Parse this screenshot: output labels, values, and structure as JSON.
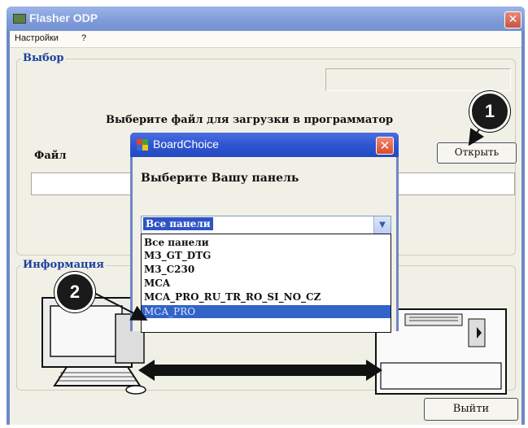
{
  "window": {
    "title": "Flasher ODP",
    "close_glyph": "✕"
  },
  "menu": {
    "items": [
      "Настройки",
      "?"
    ]
  },
  "group_choice": {
    "title": "Выбор",
    "instruction": "Выберите файл для загрузки в программатор",
    "file_label": "Файл",
    "open_button": "Открыть",
    "file_value": ""
  },
  "group_info": {
    "title": "Информация"
  },
  "exit_button": "Выйти",
  "dialog": {
    "title": "BoardChoice",
    "close_glyph": "✕",
    "prompt": "Выберите Вашу панель",
    "selected": "Все панели",
    "options": [
      "Все панели",
      "M3_GT_DTG",
      "M3_C230",
      "MCA",
      "MCA_PRO_RU_TR_RO_SI_NO_CZ",
      "MCA_PRO"
    ],
    "highlighted_option": "MCA_PRO"
  },
  "callouts": [
    "1",
    "2"
  ],
  "colors": {
    "titlebar": "#7f9ad8",
    "dialog_titlebar": "#2d54cf",
    "group_title": "#1d3fa0",
    "selection": "#3163c9",
    "callout": "#1a1a1a"
  },
  "icons": [
    "app-icon",
    "close-icon",
    "dialog-app-icon",
    "dropdown-arrow-icon",
    "computer-illustration",
    "panel-illustration"
  ]
}
